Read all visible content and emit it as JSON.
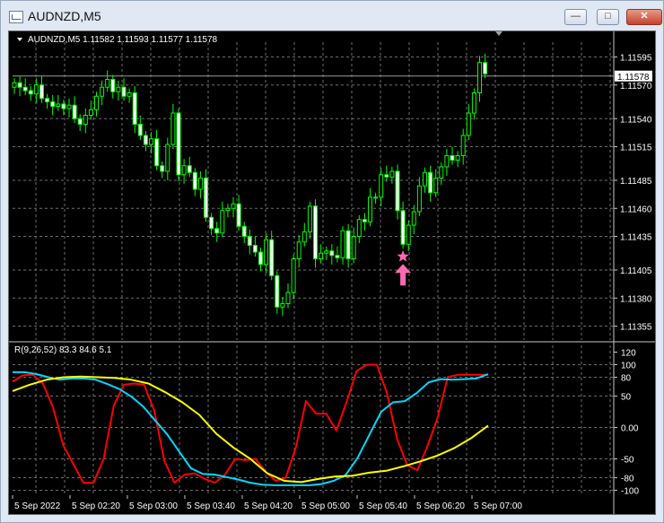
{
  "window": {
    "title": "AUDNZD,M5",
    "buttons": [
      "minimize",
      "maximize",
      "close"
    ]
  },
  "chart_data": [
    {
      "type": "candlestick",
      "header": "AUDNZD,M5  1.11582 1.11593 1.11577 1.11578",
      "current_price_label": "1.11578",
      "y_ticks": [
        "1.11595",
        "1.11570",
        "1.11540",
        "1.11515",
        "1.11485",
        "1.11460",
        "1.11435",
        "1.11405",
        "1.11380",
        "1.11355"
      ],
      "ylim": [
        1.11345,
        1.11605
      ],
      "grid": true,
      "colors": {
        "bull": "#00ff00",
        "bear_body": "#ffffff",
        "background": "#000000",
        "grid": "#6e6e6e",
        "price_line": "#9a9a9a"
      },
      "signal_markers": [
        {
          "type": "star",
          "color": "#ff69b4",
          "price": 1.11417,
          "bar": 71
        },
        {
          "type": "arrow-up",
          "color": "#ff69b4",
          "price": 1.11404,
          "bar": 71
        }
      ],
      "close": [
        1.11572,
        1.11568,
        1.11565,
        1.11562,
        1.1157,
        1.11558,
        1.11555,
        1.11551,
        1.11553,
        1.11549,
        1.11552,
        1.1154,
        1.11535,
        1.11543,
        1.11548,
        1.1156,
        1.11568,
        1.11575,
        1.11564,
        1.11568,
        1.1156,
        1.11563,
        1.11535,
        1.11525,
        1.11517,
        1.11522,
        1.11498,
        1.11493,
        1.11517,
        1.11545,
        1.1149,
        1.11498,
        1.11492,
        1.11477,
        1.11487,
        1.11452,
        1.11442,
        1.11438,
        1.11458,
        1.1146,
        1.11464,
        1.11444,
        1.11435,
        1.11427,
        1.11421,
        1.1141,
        1.11432,
        1.114,
        1.11372,
        1.11375,
        1.11385,
        1.11415,
        1.1143,
        1.11439,
        1.11462,
        1.11415,
        1.1142,
        1.11422,
        1.11418,
        1.11416,
        1.1144,
        1.11415,
        1.11435,
        1.1145,
        1.11448,
        1.1147,
        1.1147,
        1.1149,
        1.11488,
        1.11493,
        1.11458,
        1.11428,
        1.11445,
        1.11457,
        1.1148,
        1.11492,
        1.11474,
        1.11487,
        1.11497,
        1.11507,
        1.11503,
        1.11507,
        1.11525,
        1.11545,
        1.11563,
        1.1159,
        1.1158
      ]
    },
    {
      "type": "line",
      "header": "R(9,26,52) 83.3 84.6 5.1",
      "y_ticks": [
        "120",
        "100",
        "80",
        "50",
        "0.00",
        "-50",
        "-80",
        "-100"
      ],
      "ylim": [
        -105,
        125
      ],
      "x_ticks": [
        "5 Sep 2022",
        "5 Sep 02:20",
        "5 Sep 03:00",
        "5 Sep 03:40",
        "5 Sep 04:20",
        "5 Sep 05:00",
        "5 Sep 05:40",
        "5 Sep 06:20",
        "5 Sep 07:00"
      ],
      "grid": true,
      "series": [
        {
          "color": "#ff0000",
          "values": [
            73,
            83,
            84,
            70,
            32,
            -28,
            -58,
            -88,
            -88,
            -50,
            35,
            68,
            70,
            68,
            27,
            -53,
            -88,
            -75,
            -73,
            -82,
            -88,
            -75,
            -50,
            -52,
            -50,
            -70,
            -85,
            -80,
            -32,
            42,
            22,
            22,
            -5,
            40,
            90,
            100,
            100,
            55,
            -18,
            -60,
            -68,
            -30,
            15,
            80,
            84,
            84,
            84,
            84
          ]
        },
        {
          "color": "#00d8ff",
          "values": [
            88,
            88,
            85,
            80,
            76,
            78,
            78,
            76,
            69,
            61,
            49,
            33,
            11,
            -11,
            -38,
            -65,
            -74,
            -75,
            -79,
            -83,
            -88,
            -91,
            -92,
            -92,
            -92,
            -92,
            -90,
            -85,
            -76,
            -49,
            -12,
            25,
            40,
            42,
            55,
            72,
            77,
            76,
            77,
            78,
            85
          ]
        },
        {
          "color": "#ffff00",
          "values": [
            58,
            68,
            76,
            80,
            81,
            80,
            79,
            76,
            70,
            56,
            40,
            20,
            -10,
            -32,
            -50,
            -73,
            -85,
            -87,
            -82,
            -78,
            -77,
            -72,
            -69,
            -62,
            -54,
            -45,
            -33,
            -17,
            3
          ]
        }
      ]
    }
  ]
}
